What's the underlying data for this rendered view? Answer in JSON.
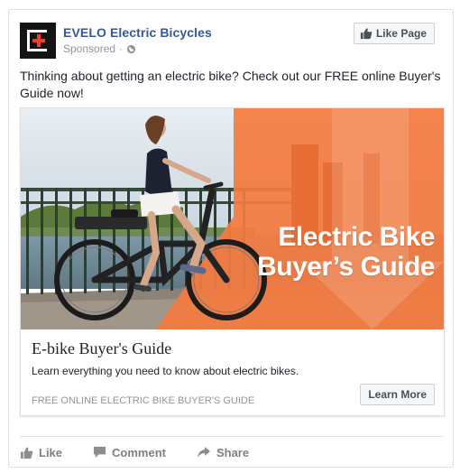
{
  "post": {
    "page_name": "EVELO Electric Bicycles",
    "sponsored_label": "Sponsored",
    "like_page_label": "Like Page",
    "body_text": "Thinking about getting an electric bike? Check out our FREE online Buyer's Guide now!"
  },
  "ad": {
    "image_headline_line1": "Electric Bike",
    "image_headline_line2": "Buyer’s Guide",
    "title": "E-bike Buyer's Guide",
    "description": "Learn everything you need to know about electric bikes.",
    "caption": "FREE ONLINE ELECTRIC BIKE BUYER'S GUIDE",
    "cta_label": "Learn More",
    "accent_color": "#f47b3f"
  },
  "actions": [
    {
      "label": "Like",
      "icon": "thumbs-up-icon"
    },
    {
      "label": "Comment",
      "icon": "comment-icon"
    },
    {
      "label": "Share",
      "icon": "share-icon"
    }
  ]
}
